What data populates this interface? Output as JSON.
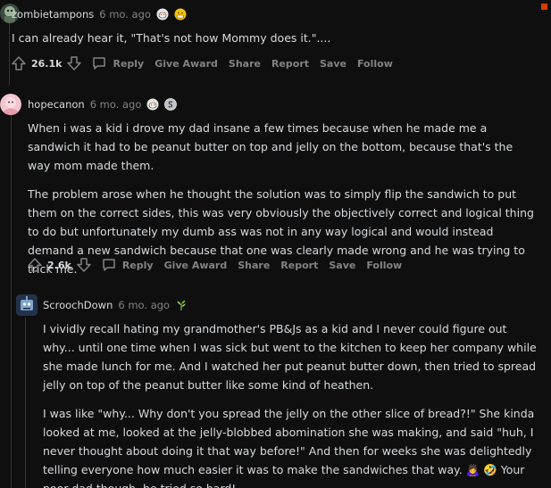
{
  "comments": [
    {
      "username": "zombietampons",
      "time": "6 mo. ago",
      "avatar_icon": "avatar-zombie-icon",
      "award_icons": [
        "snoo-award-icon",
        "grimace-award-icon"
      ],
      "paragraphs": [
        "I can already hear it, \"That's not how Mommy does it.\"...."
      ],
      "score": "26.1k",
      "actions": [
        "Reply",
        "Give Award",
        "Share",
        "Report",
        "Save",
        "Follow"
      ]
    },
    {
      "username": "hopecanon",
      "time": "6 mo. ago",
      "avatar_icon": "avatar-pink-icon",
      "award_icons": [
        "snoo-award-icon",
        "silver-award-icon"
      ],
      "paragraphs": [
        "When i was a kid i drove my dad insane a few times because when he made me a sandwich it had to be peanut butter on top and jelly on the bottom, because that's the way mom made them.",
        "The problem arose when he thought the solution was to simply flip the sandwich to put them on the correct sides, this was very obviously the objectively correct and logical thing to do but unfortunately my dumb ass was not in any way logical and would instead demand a new sandwich because that one was clearly made wrong and he was trying to trick me."
      ],
      "score": "2.6k",
      "actions": [
        "Reply",
        "Give Award",
        "Share",
        "Report",
        "Save",
        "Follow"
      ]
    },
    {
      "username": "ScroochDown",
      "time": "6 mo. ago",
      "avatar_icon": "avatar-robot-icon",
      "award_icons": [
        "plant-award-icon"
      ],
      "paragraphs": [
        "I vividly recall hating my grandmother's PB&Js as a kid and I never could figure out why... until one time when I was sick but went to the kitchen to keep her company while she made lunch for me. And I watched her put peanut butter down, then tried to spread jelly on top of the peanut butter like some kind of heathen.",
        "I was like \"why... Why don't you spread the jelly on the other slice of bread?!\" She kinda looked at me, looked at the jelly-blobbed abomination she was making, and said \"huh, I never thought about doing it that way before!\" And then for weeks she was delightedly telling everyone how much easier it was to make the sandwiches that way. 🙇‍♀️ 🤣 Your poor dad though, he tried so hard!"
      ]
    }
  ],
  "colors": {
    "background": "#0f0f10",
    "text": "#d7dadc",
    "muted": "#818384",
    "thread_line": "#343536",
    "accent_badge": "#d93a00"
  }
}
